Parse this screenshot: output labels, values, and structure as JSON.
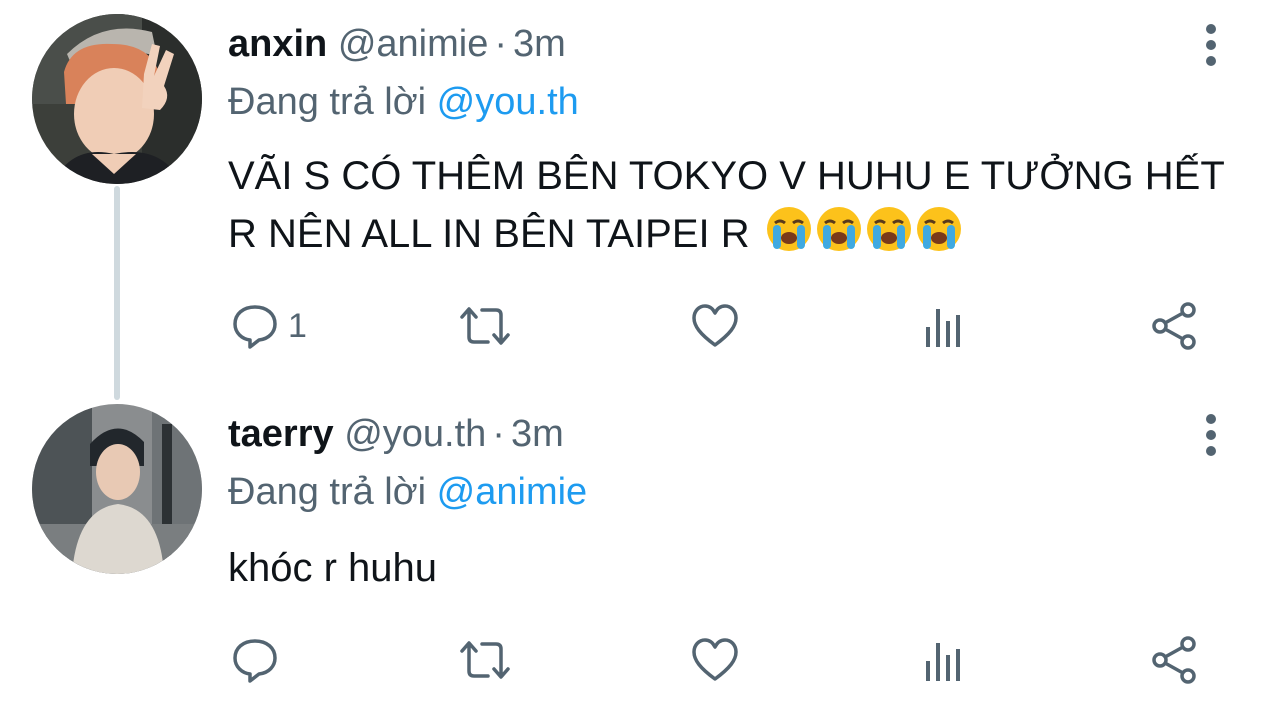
{
  "colors": {
    "text": "#0f1419",
    "secondary": "#536471",
    "mention": "#1d9bf0",
    "thread_line": "#cfd9de"
  },
  "tweets": [
    {
      "display_name": "anxin",
      "handle": "@animie",
      "separator": "·",
      "time": "3m",
      "reply_prefix": "Đang trả lời",
      "reply_to": "@you.th",
      "text": "VÃI S CÓ THÊM BÊN TOKYO V HUHU E TƯỞNG HẾT R NÊN ALL IN BÊN TAIPEI R",
      "emojis": [
        "loudly-crying-face",
        "loudly-crying-face",
        "loudly-crying-face",
        "loudly-crying-face"
      ],
      "reply_count": "1",
      "icons": [
        "reply-icon",
        "retweet-icon",
        "like-icon",
        "views-icon",
        "share-icon",
        "more-icon"
      ]
    },
    {
      "display_name": "taerry",
      "handle": "@you.th",
      "separator": "·",
      "time": "3m",
      "reply_prefix": "Đang trả lời",
      "reply_to": "@animie",
      "text": "khóc r huhu",
      "reply_count": "",
      "icons": [
        "reply-icon",
        "retweet-icon",
        "like-icon",
        "views-icon",
        "share-icon",
        "more-icon"
      ]
    }
  ]
}
